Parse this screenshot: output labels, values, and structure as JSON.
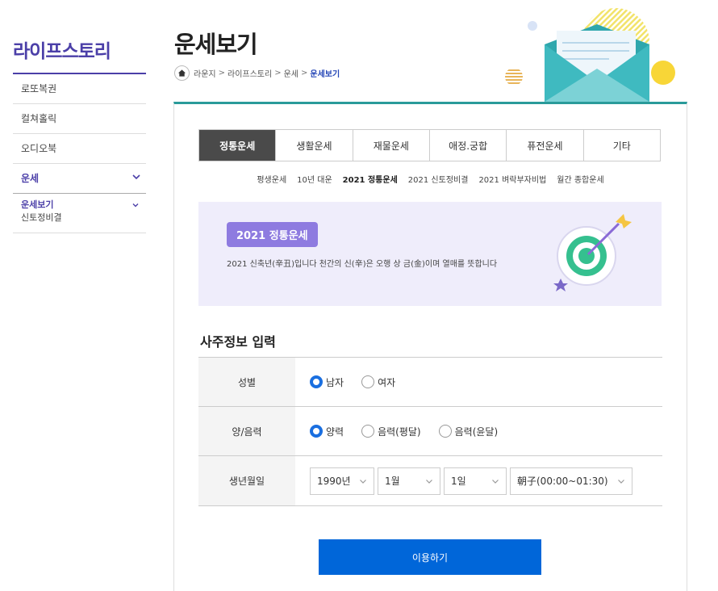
{
  "sidebar": {
    "title": "라이프스토리",
    "items": [
      {
        "label": "로또복권"
      },
      {
        "label": "컬쳐홀릭"
      },
      {
        "label": "오디오북"
      },
      {
        "label": "운세"
      }
    ],
    "sub_items": [
      {
        "label": "운세보기"
      },
      {
        "label": "신토정비결"
      }
    ]
  },
  "header": {
    "title": "운세보기",
    "breadcrumb": [
      "라운지",
      "라이프스토리",
      "운세",
      "운세보기"
    ],
    "breadcrumb_sep": ">"
  },
  "tabs": [
    {
      "label": "정통운세"
    },
    {
      "label": "생활운세"
    },
    {
      "label": "재물운세"
    },
    {
      "label": "애정.궁합"
    },
    {
      "label": "퓨전운세"
    },
    {
      "label": "기타"
    }
  ],
  "subtabs": [
    {
      "label": "평생운세"
    },
    {
      "label": "10년 대운"
    },
    {
      "label": "2021 정통운세"
    },
    {
      "label": "2021 신토정비결"
    },
    {
      "label": "2021 벼락부자비법"
    },
    {
      "label": "월간 종합운세"
    }
  ],
  "banner": {
    "badge": "2021 정통운세",
    "description": "2021 신축년(辛丑)입니다 천간의 신(辛)은 오행 상 금(金)이며 열매를 뜻합니다"
  },
  "form": {
    "section_title": "사주정보 입력",
    "gender": {
      "label": "성별",
      "options": [
        "남자",
        "여자"
      ],
      "selected": "남자"
    },
    "calendar": {
      "label": "양/음력",
      "options": [
        "양력",
        "음력(평달)",
        "음력(윤달)"
      ],
      "selected": "양력"
    },
    "birth": {
      "label": "생년월일",
      "year": "1990년",
      "month": "1월",
      "day": "1일",
      "hour": "朝子(00:00~01:30)"
    },
    "submit_label": "이용하기"
  },
  "colors": {
    "brand_purple": "#4b3fa8",
    "accent_teal": "#2a9b9a",
    "button_blue": "#0066d9",
    "banner_bg": "#efedfb",
    "badge": "#8e7be0"
  }
}
